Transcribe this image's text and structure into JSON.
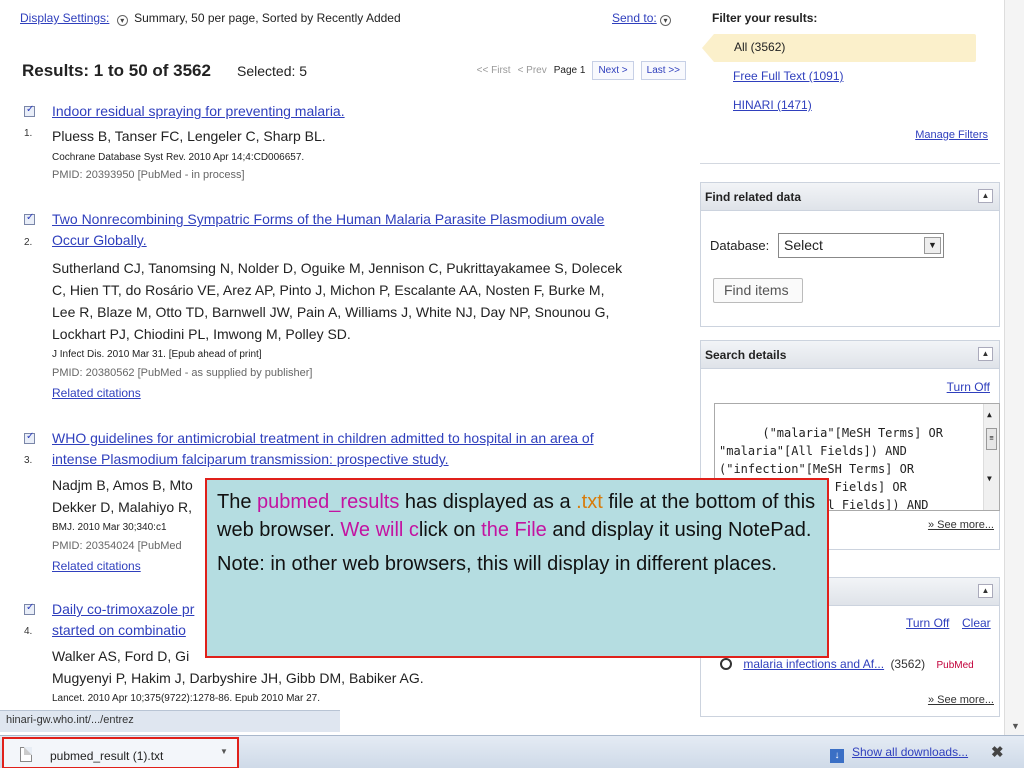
{
  "display_bar": {
    "settings_label": "Display Settings:",
    "settings_value": "Summary, 50 per page, Sorted by Recently Added",
    "send_to": "Send to:"
  },
  "results_header": {
    "title": "Results: 1 to 50 of 3562",
    "selected": "Selected: 5",
    "first": "<< First",
    "prev": "< Prev",
    "page": "Page 1",
    "next": "Next >",
    "last": "Last >>"
  },
  "results": [
    {
      "num": "1.",
      "title_lines": [
        "Indoor residual spraying for preventing malaria."
      ],
      "authors": "Pluess B, Tanser FC, Lengeler C, Sharp BL.",
      "journal": "Cochrane Database Syst Rev. 2010 Apr 14;4:CD006657.",
      "pmid": "PMID: 20393950 [PubMed - in process]"
    },
    {
      "num": "2.",
      "title_lines": [
        "Two Nonrecombining Sympatric Forms of the Human Malaria Parasite Plasmodium ovale",
        "Occur Globally."
      ],
      "authors_lines": [
        "Sutherland CJ, Tanomsing N, Nolder D, Oguike M, Jennison C, Pukrittayakamee S, Dolecek",
        "C, Hien TT, do Rosário VE, Arez AP, Pinto J, Michon P, Escalante AA, Nosten F, Burke M,",
        "Lee R, Blaze M, Otto TD, Barnwell JW, Pain A, Williams J, White NJ, Day NP, Snounou G,",
        "Lockhart PJ, Chiodini PL, Imwong M, Polley SD."
      ],
      "journal": "J Infect Dis. 2010 Mar 31. [Epub ahead of print]",
      "pmid": "PMID: 20380562 [PubMed - as supplied by publisher]",
      "related": "Related citations"
    },
    {
      "num": "3.",
      "title_lines": [
        "WHO guidelines for antimicrobial treatment in children admitted to hospital in an area of",
        "intense Plasmodium falciparum transmission: prospective study."
      ],
      "authors_lines": [
        "Nadjm B, Amos B, Mto",
        "Dekker D, Malahiyo R,"
      ],
      "journal": "BMJ. 2010 Mar 30;340:c1",
      "pmid": "PMID: 20354024 [PubMed",
      "related": "Related citations"
    },
    {
      "num": "4.",
      "title_lines": [
        "Daily co-trimoxazole pr",
        "started on combinatio"
      ],
      "authors_lines": [
        "Walker AS, Ford D, Gi",
        "Mugyenyi P, Hakim J, Darbyshire JH, Gibb DM, Babiker AG."
      ],
      "journal": "Lancet. 2010 Apr 10;375(9722):1278-86. Epub 2010 Mar 27."
    }
  ],
  "status_url": "hinari-gw.who.int/.../entrez",
  "filter": {
    "title": "Filter your results:",
    "all": "All (3562)",
    "free_full_text": "Free Full Text (1091)",
    "hinari": "HINARI (1471)",
    "manage": "Manage Filters"
  },
  "find_related": {
    "title": "Find related data",
    "db_label": "Database:",
    "db_value": "Select",
    "button": "Find items"
  },
  "search_details": {
    "title": "Search details",
    "turn_off": "Turn Off",
    "query": "(\"malaria\"[MeSH Terms] OR\n\"malaria\"[All Fields]) AND\n(\"infection\"[MeSH Terms] OR\n\"infection\"[All Fields] OR\n\"infections\"[All Fields]) AND",
    "see_more": "» See more..."
  },
  "recent": {
    "turn_off": "Turn Off",
    "clear": "Clear",
    "query": "malaria infections and Af...",
    "count": "(3562)",
    "source": "PubMed",
    "see_more": "» See more..."
  },
  "callout": {
    "p1_a": "The ",
    "p1_hl1": "pubmed_results",
    "p1_b": " has displayed as a ",
    "p1_hl2": ".txt",
    "p1_c": " file at the bottom of this web browser.   ",
    "p1_hl3": "We will c",
    "p1_d": "lick on ",
    "p1_hl4": "the File",
    "p1_e": " and display it using NotePad.",
    "p2": "Note: in other web browsers, this will display in different places."
  },
  "download_bar": {
    "file_name": "pubmed_result (1).txt",
    "show_all": "Show all downloads...",
    "close": "✖"
  }
}
